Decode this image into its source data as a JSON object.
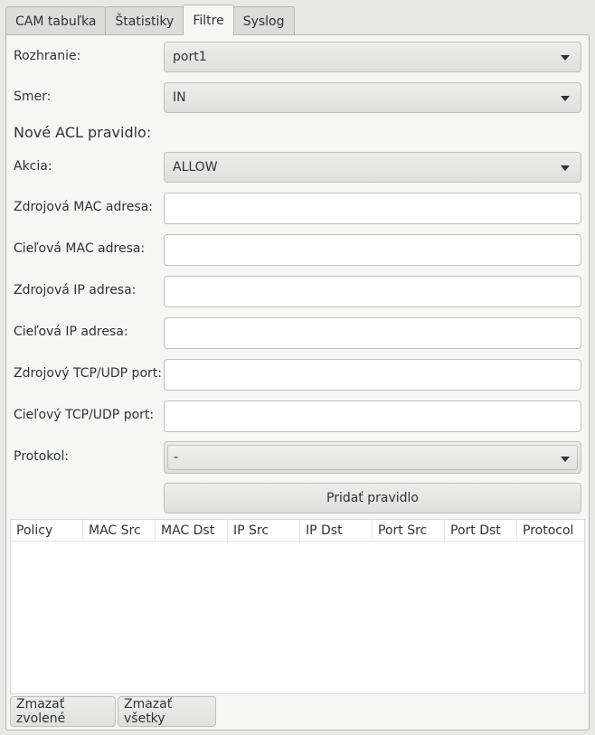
{
  "tabs": [
    "CAM tabuľka",
    "Štatistiky",
    "Filtre",
    "Syslog"
  ],
  "active_tab": "Filtre",
  "form": {
    "interface_label": "Rozhranie:",
    "interface_value": "port1",
    "direction_label": "Smer:",
    "direction_value": "IN",
    "new_rule_title": "Nové ACL pravidlo:",
    "action_label": "Akcia:",
    "action_value": "ALLOW",
    "src_mac_label": "Zdrojová MAC adresa:",
    "src_mac_value": "",
    "dst_mac_label": "Cieľová MAC adresa:",
    "dst_mac_value": "",
    "src_ip_label": "Zdrojová IP adresa:",
    "src_ip_value": "",
    "dst_ip_label": "Cieľová IP adresa:",
    "dst_ip_value": "",
    "src_port_label": "Zdrojový TCP/UDP port:",
    "src_port_value": "",
    "dst_port_label": "Cieľový TCP/UDP port:",
    "dst_port_value": "",
    "protocol_label": "Protokol:",
    "protocol_value": "-",
    "add_rule_button": "Pridať pravidlo"
  },
  "table": {
    "columns": [
      "Policy",
      "MAC Src",
      "MAC Dst",
      "IP Src",
      "IP Dst",
      "Port Src",
      "Port Dst",
      "Protocol"
    ],
    "rows": []
  },
  "bottom": {
    "delete_selected": "Zmazať zvolené",
    "delete_all": "Zmazať všetky"
  }
}
